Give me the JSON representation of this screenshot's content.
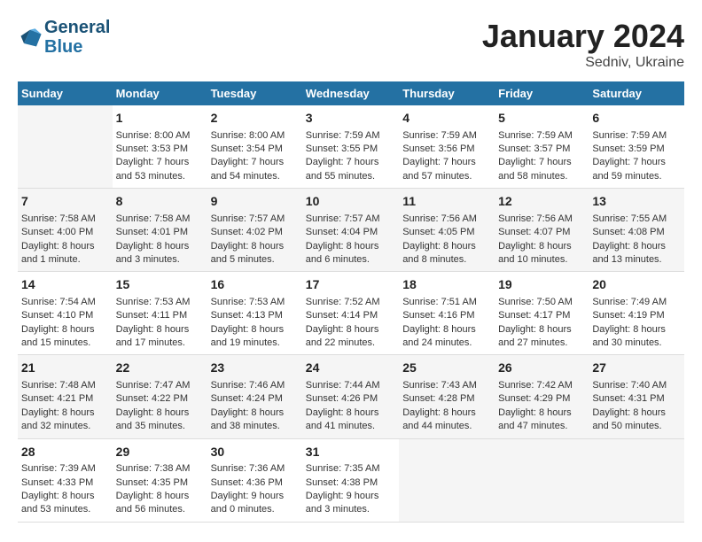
{
  "header": {
    "logo_line1": "General",
    "logo_line2": "Blue",
    "title": "January 2024",
    "subtitle": "Sedniv, Ukraine"
  },
  "weekdays": [
    "Sunday",
    "Monday",
    "Tuesday",
    "Wednesday",
    "Thursday",
    "Friday",
    "Saturday"
  ],
  "weeks": [
    [
      {
        "day": "",
        "info": ""
      },
      {
        "day": "1",
        "info": "Sunrise: 8:00 AM\nSunset: 3:53 PM\nDaylight: 7 hours and 53 minutes."
      },
      {
        "day": "2",
        "info": "Sunrise: 8:00 AM\nSunset: 3:54 PM\nDaylight: 7 hours and 54 minutes."
      },
      {
        "day": "3",
        "info": "Sunrise: 7:59 AM\nSunset: 3:55 PM\nDaylight: 7 hours and 55 minutes."
      },
      {
        "day": "4",
        "info": "Sunrise: 7:59 AM\nSunset: 3:56 PM\nDaylight: 7 hours and 57 minutes."
      },
      {
        "day": "5",
        "info": "Sunrise: 7:59 AM\nSunset: 3:57 PM\nDaylight: 7 hours and 58 minutes."
      },
      {
        "day": "6",
        "info": "Sunrise: 7:59 AM\nSunset: 3:59 PM\nDaylight: 7 hours and 59 minutes."
      }
    ],
    [
      {
        "day": "7",
        "info": "Sunrise: 7:58 AM\nSunset: 4:00 PM\nDaylight: 8 hours and 1 minute."
      },
      {
        "day": "8",
        "info": "Sunrise: 7:58 AM\nSunset: 4:01 PM\nDaylight: 8 hours and 3 minutes."
      },
      {
        "day": "9",
        "info": "Sunrise: 7:57 AM\nSunset: 4:02 PM\nDaylight: 8 hours and 5 minutes."
      },
      {
        "day": "10",
        "info": "Sunrise: 7:57 AM\nSunset: 4:04 PM\nDaylight: 8 hours and 6 minutes."
      },
      {
        "day": "11",
        "info": "Sunrise: 7:56 AM\nSunset: 4:05 PM\nDaylight: 8 hours and 8 minutes."
      },
      {
        "day": "12",
        "info": "Sunrise: 7:56 AM\nSunset: 4:07 PM\nDaylight: 8 hours and 10 minutes."
      },
      {
        "day": "13",
        "info": "Sunrise: 7:55 AM\nSunset: 4:08 PM\nDaylight: 8 hours and 13 minutes."
      }
    ],
    [
      {
        "day": "14",
        "info": "Sunrise: 7:54 AM\nSunset: 4:10 PM\nDaylight: 8 hours and 15 minutes."
      },
      {
        "day": "15",
        "info": "Sunrise: 7:53 AM\nSunset: 4:11 PM\nDaylight: 8 hours and 17 minutes."
      },
      {
        "day": "16",
        "info": "Sunrise: 7:53 AM\nSunset: 4:13 PM\nDaylight: 8 hours and 19 minutes."
      },
      {
        "day": "17",
        "info": "Sunrise: 7:52 AM\nSunset: 4:14 PM\nDaylight: 8 hours and 22 minutes."
      },
      {
        "day": "18",
        "info": "Sunrise: 7:51 AM\nSunset: 4:16 PM\nDaylight: 8 hours and 24 minutes."
      },
      {
        "day": "19",
        "info": "Sunrise: 7:50 AM\nSunset: 4:17 PM\nDaylight: 8 hours and 27 minutes."
      },
      {
        "day": "20",
        "info": "Sunrise: 7:49 AM\nSunset: 4:19 PM\nDaylight: 8 hours and 30 minutes."
      }
    ],
    [
      {
        "day": "21",
        "info": "Sunrise: 7:48 AM\nSunset: 4:21 PM\nDaylight: 8 hours and 32 minutes."
      },
      {
        "day": "22",
        "info": "Sunrise: 7:47 AM\nSunset: 4:22 PM\nDaylight: 8 hours and 35 minutes."
      },
      {
        "day": "23",
        "info": "Sunrise: 7:46 AM\nSunset: 4:24 PM\nDaylight: 8 hours and 38 minutes."
      },
      {
        "day": "24",
        "info": "Sunrise: 7:44 AM\nSunset: 4:26 PM\nDaylight: 8 hours and 41 minutes."
      },
      {
        "day": "25",
        "info": "Sunrise: 7:43 AM\nSunset: 4:28 PM\nDaylight: 8 hours and 44 minutes."
      },
      {
        "day": "26",
        "info": "Sunrise: 7:42 AM\nSunset: 4:29 PM\nDaylight: 8 hours and 47 minutes."
      },
      {
        "day": "27",
        "info": "Sunrise: 7:40 AM\nSunset: 4:31 PM\nDaylight: 8 hours and 50 minutes."
      }
    ],
    [
      {
        "day": "28",
        "info": "Sunrise: 7:39 AM\nSunset: 4:33 PM\nDaylight: 8 hours and 53 minutes."
      },
      {
        "day": "29",
        "info": "Sunrise: 7:38 AM\nSunset: 4:35 PM\nDaylight: 8 hours and 56 minutes."
      },
      {
        "day": "30",
        "info": "Sunrise: 7:36 AM\nSunset: 4:36 PM\nDaylight: 9 hours and 0 minutes."
      },
      {
        "day": "31",
        "info": "Sunrise: 7:35 AM\nSunset: 4:38 PM\nDaylight: 9 hours and 3 minutes."
      },
      {
        "day": "",
        "info": ""
      },
      {
        "day": "",
        "info": ""
      },
      {
        "day": "",
        "info": ""
      }
    ]
  ]
}
